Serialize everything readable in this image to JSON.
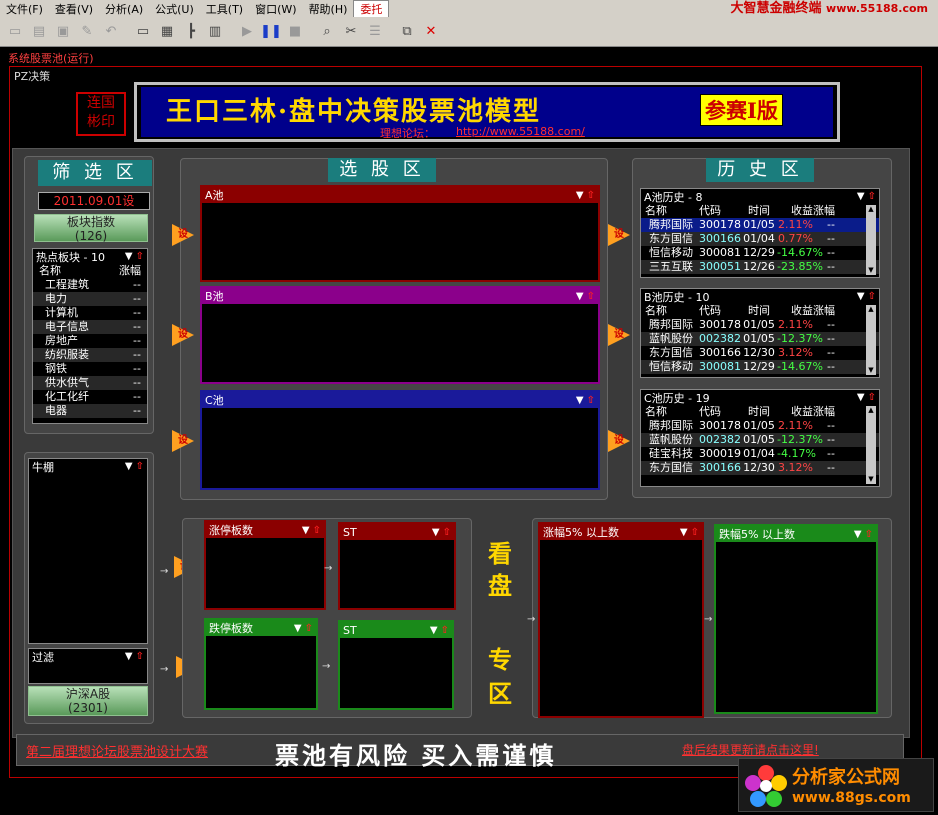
{
  "menubar": {
    "items": [
      "文件(F)",
      "查看(V)",
      "分析(A)",
      "公式(U)",
      "工具(T)",
      "窗口(W)",
      "帮助(H)"
    ],
    "active": "委托",
    "brand": "大智慧金融终端",
    "brand_url": "www.55188.com"
  },
  "system_label": "系统股票池(运行)",
  "pz_label": "PZ决策",
  "seal_text": [
    "连国",
    "彬印"
  ],
  "banner": {
    "title": "王口三林·盘中决策股票池模型",
    "badge": "参赛I版",
    "forum_label": "理想论坛：",
    "forum_url": "http://www.55188.com/"
  },
  "sections": {
    "filter": "筛 选 区",
    "pick": "选 股 区",
    "history": "历 史 区"
  },
  "filter": {
    "date": "2011.09.01设",
    "sector_btn": "板块指数",
    "sector_count": "(126)",
    "hot_title": "热点板块 - 10",
    "col_name": "名称",
    "col_chg": "涨幅",
    "items": [
      {
        "name": "工程建筑",
        "chg": "--"
      },
      {
        "name": "电力",
        "chg": "--"
      },
      {
        "name": "计算机",
        "chg": "--"
      },
      {
        "name": "电子信息",
        "chg": "--"
      },
      {
        "name": "房地产",
        "chg": "--"
      },
      {
        "name": "纺织服装",
        "chg": "--"
      },
      {
        "name": "钢铁",
        "chg": "--"
      },
      {
        "name": "供水供气",
        "chg": "--"
      },
      {
        "name": "化工化纤",
        "chg": "--"
      },
      {
        "name": "电器",
        "chg": "--"
      }
    ],
    "bull_title": "牛棚",
    "filter_title": "过滤",
    "market_btn": "沪深A股",
    "market_count": "(2301)"
  },
  "set_label": "设",
  "pools": {
    "a": "A池",
    "b": "B池",
    "c": "C池"
  },
  "history": {
    "cols": {
      "name": "名称",
      "code": "代码",
      "time": "时间",
      "ret": "收益",
      "chg": "涨幅"
    },
    "a": {
      "title": "A池历史 - 8",
      "rows": [
        {
          "name": "腾邦国际",
          "code": "300178",
          "time": "01/05",
          "ret": "2.11%",
          "chg": "--"
        },
        {
          "name": "东方国信",
          "code": "300166",
          "time": "01/04",
          "ret": "0.77%",
          "chg": "--"
        },
        {
          "name": "恒信移动",
          "code": "300081",
          "time": "12/29",
          "ret": "-14.67%",
          "chg": "--"
        },
        {
          "name": "三五互联",
          "code": "300051",
          "time": "12/26",
          "ret": "-23.85%",
          "chg": "--"
        }
      ]
    },
    "b": {
      "title": "B池历史 - 10",
      "rows": [
        {
          "name": "腾邦国际",
          "code": "300178",
          "time": "01/05",
          "ret": "2.11%",
          "chg": "--"
        },
        {
          "name": "蓝帆股份",
          "code": "002382",
          "time": "01/05",
          "ret": "-12.37%",
          "chg": "--"
        },
        {
          "name": "东方国信",
          "code": "300166",
          "time": "12/30",
          "ret": "3.12%",
          "chg": "--"
        },
        {
          "name": "恒信移动",
          "code": "300081",
          "time": "12/29",
          "ret": "-14.67%",
          "chg": "--"
        }
      ]
    },
    "c": {
      "title": "C池历史 - 19",
      "rows": [
        {
          "name": "腾邦国际",
          "code": "300178",
          "time": "01/05",
          "ret": "2.11%",
          "chg": "--"
        },
        {
          "name": "蓝帆股份",
          "code": "002382",
          "time": "01/05",
          "ret": "-12.37%",
          "chg": "--"
        },
        {
          "name": "硅宝科技",
          "code": "300019",
          "time": "01/04",
          "ret": "-4.17%",
          "chg": "--"
        },
        {
          "name": "东方国信",
          "code": "300166",
          "time": "12/30",
          "ret": "3.12%",
          "chg": "--"
        }
      ]
    }
  },
  "lower": {
    "limit_up": "涨停板数",
    "st1": "ST",
    "limit_down": "跌停板数",
    "st2": "ST",
    "rise5": "涨幅5% 以上数",
    "fall5": "跌幅5% 以上数",
    "kanpan": [
      "看",
      "盘",
      "专",
      "区"
    ]
  },
  "footer": {
    "left": "第二届理想论坛股票池设计大赛",
    "mid": "票池有风险  买入需谨慎",
    "right": "盘后结果更新请点击这里!"
  },
  "watermark": {
    "title": "分析家公式网",
    "url": "www.88gs.com"
  }
}
